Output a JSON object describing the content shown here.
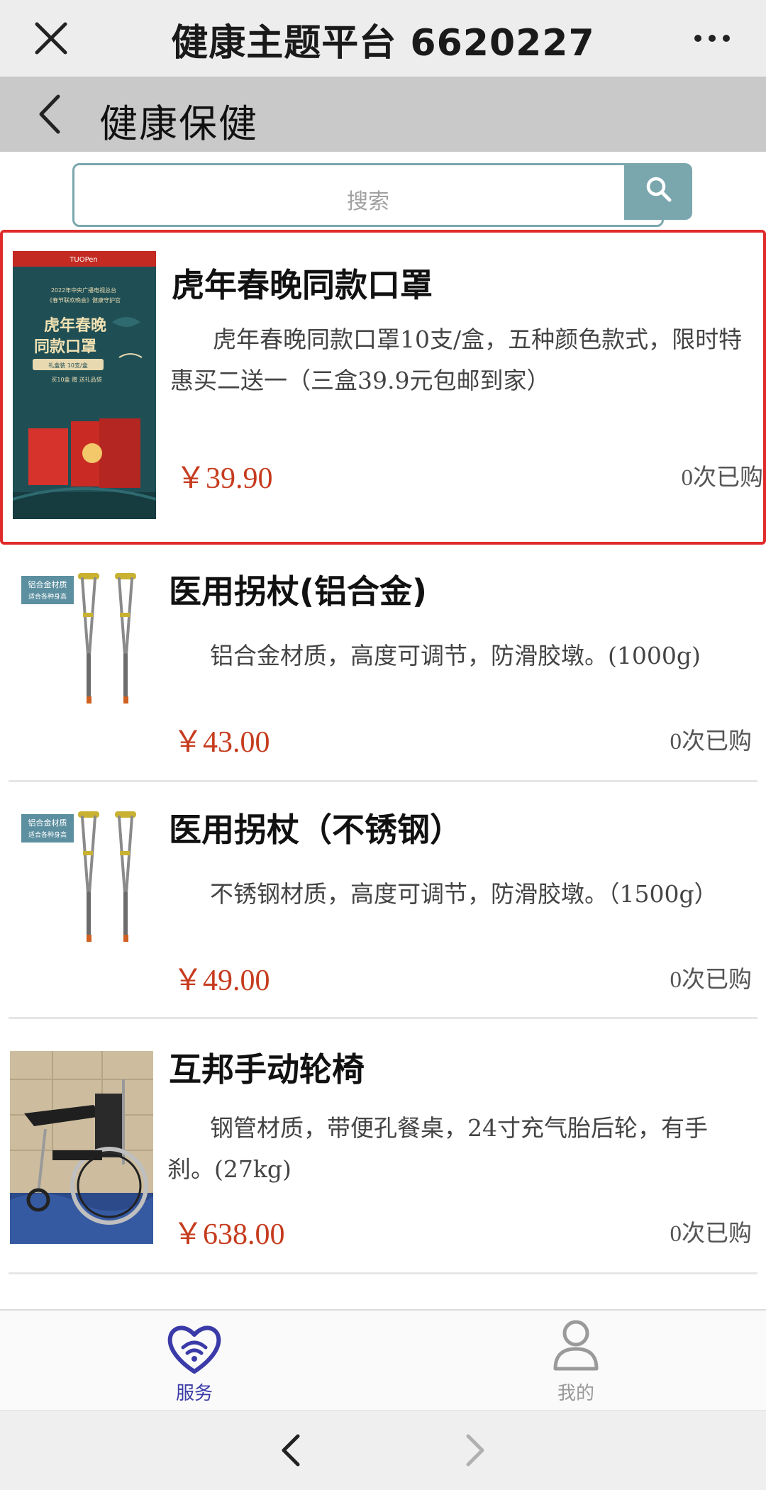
{
  "topbar": {
    "title": "健康主题平台 6620227",
    "close_icon": "close-icon",
    "more_icon": "more-icon"
  },
  "header": {
    "title": "健康保健",
    "back_icon": "chevron-left-icon"
  },
  "search": {
    "placeholder": "搜索",
    "button_icon": "search-icon"
  },
  "products": [
    {
      "name": "虎年春晚同款口罩",
      "description": "虎年春晚同款口罩10支/盒，五种颜色款式，限时特惠买二送一（三盒39.9元包邮到家）",
      "price": "￥39.90",
      "sold": "0次已购",
      "thumb_icon": "mask-product-image",
      "thumb_text": {
        "brand": "TUOPen",
        "line1": "2022年中央广播电视总台",
        "line2": "《春节联欢晚会》健康守护官",
        "headline1": "虎年春晚",
        "headline2": "同款口罩",
        "pack": "礼盒装 10支/盒",
        "promo": "买10盒 赠 送礼品袋"
      }
    },
    {
      "name": "医用拐杖(铝合金)",
      "description": "铝合金材质，高度可调节，防滑胶墩。(1000g)",
      "price": "￥43.00",
      "sold": "0次已购",
      "thumb_icon": "crutches-product-image",
      "thumb_text": {
        "tag1": "铝合金材质",
        "tag2": "适合各种身高"
      }
    },
    {
      "name": "医用拐杖（不锈钢）",
      "description": "不锈钢材质，高度可调节，防滑胶墩。（1500g）",
      "price": "￥49.00",
      "sold": "0次已购",
      "thumb_icon": "crutches-product-image",
      "thumb_text": {
        "tag1": "铝合金材质",
        "tag2": "适合各种身高"
      }
    },
    {
      "name": "互邦手动轮椅",
      "description": "钢管材质，带便孔餐桌，24寸充气胎后轮，有手刹。(27kg)",
      "price": "￥638.00",
      "sold": "0次已购",
      "thumb_icon": "wheelchair-product-image"
    }
  ],
  "tabbar": {
    "service_label": "服务",
    "mine_label": "我的",
    "service_icon": "heart-wifi-icon",
    "mine_icon": "user-icon",
    "active_color": "#3a3aa8"
  },
  "browser": {
    "back_icon": "chevron-left-icon",
    "forward_icon": "chevron-right-icon"
  },
  "colors": {
    "price": "#c63b1e",
    "highlight_border": "#e02a2a",
    "search_accent": "#7aa7ad"
  }
}
